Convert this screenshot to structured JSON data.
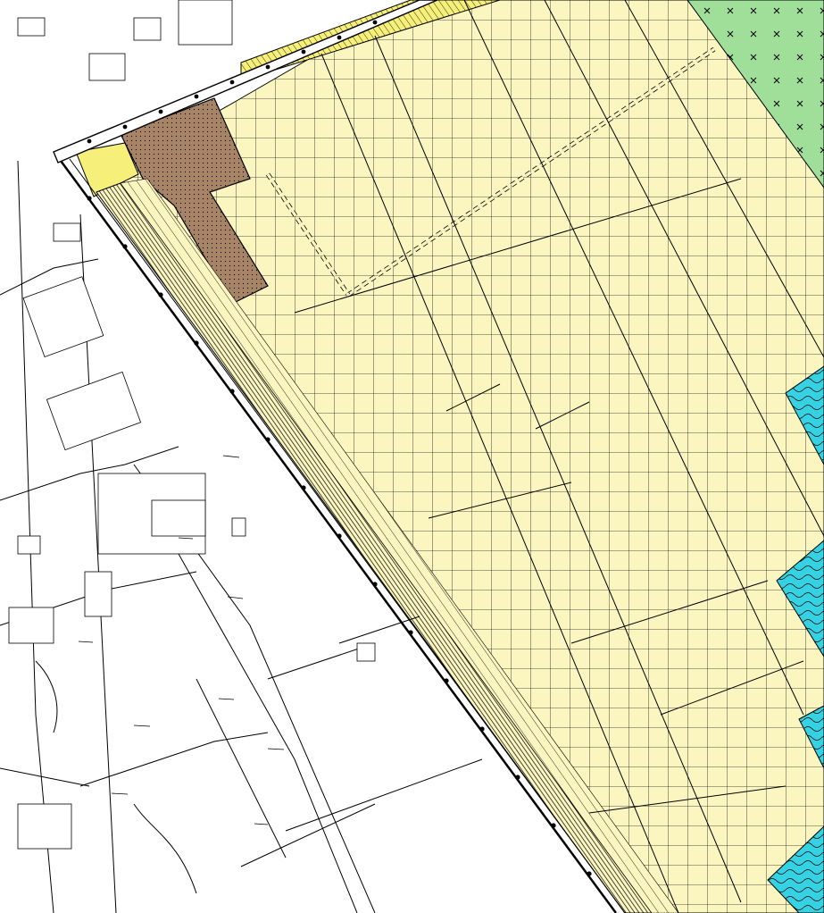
{
  "map": {
    "colors": {
      "agriculture": "#fbf6c0",
      "grid_line": "#1a1a1a",
      "residential_yellow": "#f6f07a",
      "brown_zone": "#a88466",
      "green_zone": "#9fdf9a",
      "water_blue": "#34d2e3",
      "line": "#000000"
    },
    "legend_zones": [
      {
        "key": "agriculture",
        "pattern": "grid"
      },
      {
        "key": "green_zone",
        "pattern": "cross"
      },
      {
        "key": "water_blue",
        "pattern": "waves"
      },
      {
        "key": "brown_zone",
        "pattern": "dots"
      },
      {
        "key": "residential_yellow",
        "pattern": "hatch"
      }
    ]
  }
}
